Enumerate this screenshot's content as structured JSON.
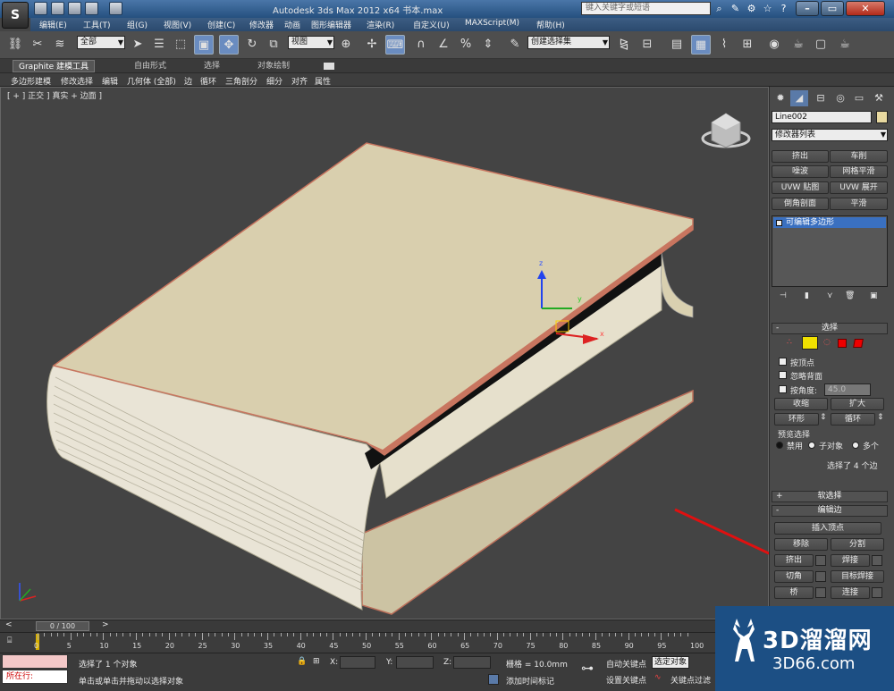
{
  "window": {
    "title": "Autodesk 3ds Max  2012 x64     书本.max",
    "search_placeholder": "键入关键字或短语"
  },
  "menu": [
    "编辑(E)",
    "工具(T)",
    "组(G)",
    "视图(V)",
    "创建(C)",
    "修改器",
    "动画",
    "图形编辑器",
    "渲染(R)",
    "自定义(U)",
    "MAXScript(M)",
    "帮助(H)"
  ],
  "toolbar": {
    "selection_filter": "全部",
    "ref_coord": "视图",
    "named_selection": "创建选择集"
  },
  "ribbon": {
    "tabs": [
      "Graphite 建模工具",
      "自由形式",
      "选择",
      "对象绘制"
    ]
  },
  "subribbon": [
    "多边形建模",
    "修改选择",
    "编辑",
    "几何体 (全部)",
    "边",
    "循环",
    "三角剖分",
    "细分",
    "对齐",
    "属性"
  ],
  "viewport": {
    "label": "[ + ] 正交 ] 真实 + 边面 ]"
  },
  "panel": {
    "object_name": "Line002",
    "modifier_list": "修改器列表",
    "modifier_buttons": [
      "挤出",
      "车削",
      "噪波",
      "网格平滑",
      "UVW 贴图",
      "UVW 展开",
      "倒角剖面",
      "平滑"
    ],
    "stack_item": "可编辑多边形",
    "selection": {
      "title": "选择",
      "by_vertex": "按顶点",
      "ignore_backfacing": "忽略背面",
      "by_angle": "按角度:",
      "angle_value": "45.0",
      "shrink": "收缩",
      "grow": "扩大",
      "ring": "环形",
      "loop": "循环",
      "preview_selection": "预览选择",
      "disable": "禁用",
      "subobject": "子对象",
      "multi": "多个",
      "selected_count": "选择了 4 个边"
    },
    "soft_selection": "软选择",
    "edit_edges": {
      "title": "编辑边",
      "insert_vertex": "插入顶点",
      "remove": "移除",
      "split": "分割",
      "extrude": "挤出",
      "weld": "焊接",
      "chamfer": "切角",
      "target_weld": "目标焊接",
      "bridge": "桥",
      "connect": "连接"
    }
  },
  "timeline": {
    "slider": "0 / 100",
    "ticks": [
      "0",
      "5",
      "10",
      "15",
      "20",
      "25",
      "30",
      "35",
      "40",
      "45",
      "50",
      "55",
      "60",
      "65",
      "70",
      "75",
      "80",
      "85",
      "90",
      "95",
      "100"
    ]
  },
  "status": {
    "mini_listener": "所在行:",
    "selected": "选择了 1 个对象",
    "prompt": "单击或单击并拖动以选择对象",
    "x_label": "X:",
    "y_label": "Y:",
    "z_label": "Z:",
    "grid": "栅格 = 10.0mm",
    "add_time_tag": "添加时间标记",
    "auto_key": "自动关键点",
    "set_key": "设置关键点",
    "selected_set": "选定对象",
    "key_filters": "关键点过滤"
  },
  "watermark": {
    "big": "3D溜溜网",
    "small": "3D66.com"
  },
  "colors": {
    "accent_blue": "#6a8cc0",
    "book_cover": "#d9cfae",
    "book_edge": "#c8755f",
    "annotation_red": "#e01010"
  }
}
